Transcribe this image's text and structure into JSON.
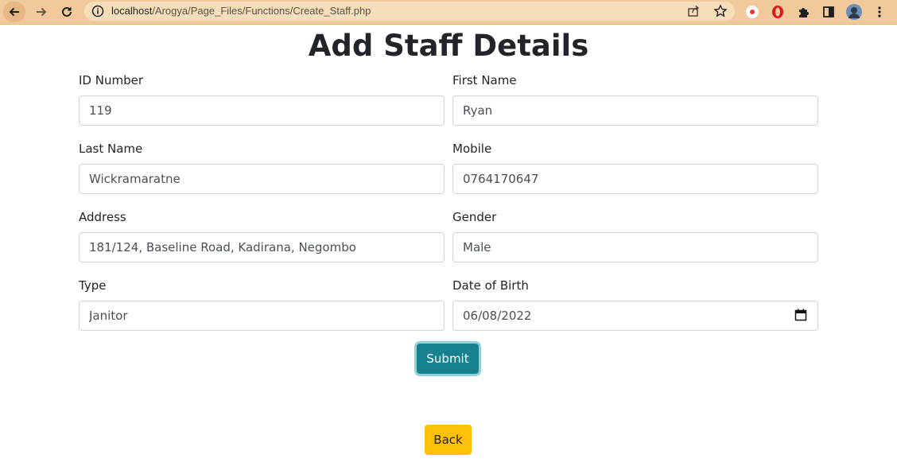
{
  "browser": {
    "url_host": "localhost",
    "url_path": "/Arogya/Page_Files/Functions/Create_Staff.php",
    "icons": [
      "back-arrow-icon",
      "forward-arrow-icon",
      "reload-icon",
      "info-icon",
      "share-icon",
      "star-icon",
      "record-extension-icon",
      "opera-extension-icon",
      "puzzle-icon",
      "side-panel-icon",
      "avatar",
      "more-menu-icon"
    ]
  },
  "page": {
    "title": "Add Staff Details"
  },
  "form": {
    "id_number": {
      "label": "ID Number",
      "value": "119"
    },
    "first_name": {
      "label": "First Name",
      "value": "Ryan"
    },
    "last_name": {
      "label": "Last Name",
      "value": "Wickramaratne"
    },
    "mobile": {
      "label": "Mobile",
      "value": "0764170647"
    },
    "address": {
      "label": "Address",
      "value": "181/124, Baseline Road, Kadirana, Negombo"
    },
    "gender": {
      "label": "Gender",
      "value": "Male"
    },
    "type": {
      "label": "Type",
      "value": "Janitor"
    },
    "dob": {
      "label": "Date of Birth",
      "value": "06/08/2022"
    },
    "submit_label": "Submit"
  },
  "back_label": "Back",
  "colors": {
    "submit": "#17818f",
    "back": "#ffc107",
    "browser_bar": "#f2c99a"
  }
}
